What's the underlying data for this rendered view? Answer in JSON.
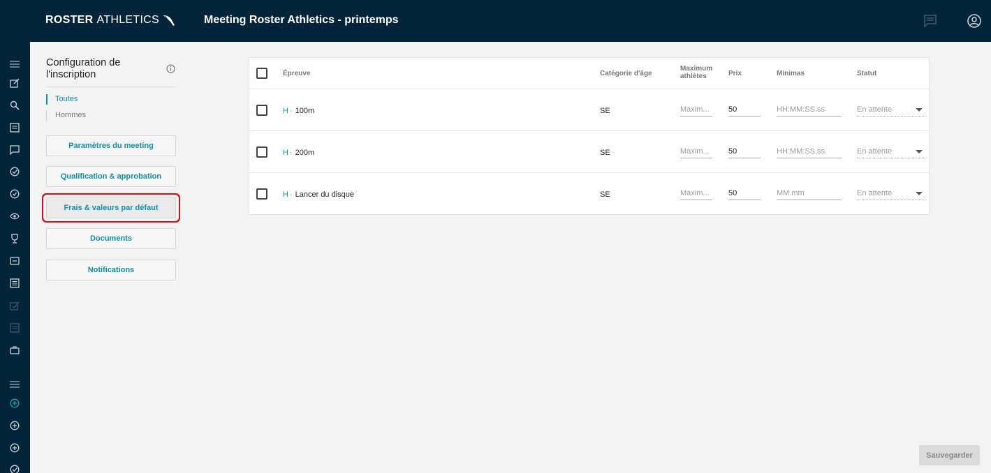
{
  "header": {
    "logo_bold": "ROSTER",
    "logo_light": "ATHLETICS",
    "title": "Meeting Roster Athletics - printemps"
  },
  "rail": {
    "icons": [
      "menu-icon",
      "edit-icon",
      "search-icon",
      "list-icon",
      "comment-icon",
      "check-circle-icon",
      "check-circle-icon",
      "eye-icon",
      "trophy-icon",
      "scoreboard-icon",
      "report-icon",
      "edit-disabled-icon",
      "list-disabled-icon",
      "briefcase-icon",
      "menu-icon",
      "add-circle-icon",
      "add-circle-icon",
      "add-circle-icon",
      "check-circle-icon"
    ]
  },
  "panel": {
    "title": "Configuration de l'inscription",
    "filters": [
      "Toutes",
      "Hommes"
    ],
    "buttons": [
      "Paramètres du meeting",
      "Qualification & approbation",
      "Frais & valeurs par défaut",
      "Documents",
      "Notifications"
    ],
    "selected_button": "Frais & valeurs par défaut"
  },
  "table": {
    "columns": {
      "event": "Épreuve",
      "age": "Catégorie d'âge",
      "max_line1": "Maximum",
      "max_line2": "athlètes",
      "price": "Prix",
      "minimas": "Minimas",
      "status": "Statut"
    },
    "rows": [
      {
        "gender": "H",
        "event": "100m",
        "age": "SE",
        "max_placeholder": "Maxim...",
        "price": "50",
        "minimas_placeholder": "HH:MM:SS.ss",
        "status": "En attente"
      },
      {
        "gender": "H",
        "event": "200m",
        "age": "SE",
        "max_placeholder": "Maxim...",
        "price": "50",
        "minimas_placeholder": "HH:MM:SS.ss",
        "status": "En attente"
      },
      {
        "gender": "H",
        "event": "Lancer du disque",
        "age": "SE",
        "max_placeholder": "Maxim...",
        "price": "50",
        "minimas_placeholder": "MM.mm",
        "status": "En attente"
      }
    ]
  },
  "footer": {
    "save_label": "Sauvegarder"
  },
  "colors": {
    "header_bg": "#04243a",
    "accent": "#0d8fa4",
    "highlight": "#d4101c"
  }
}
